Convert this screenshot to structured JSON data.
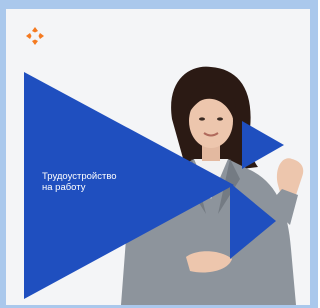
{
  "banner": {
    "caption": "Трудоустройство\nна работу"
  },
  "colors": {
    "outer_background": "#aac8ec",
    "card_background": "#f4f5f7",
    "triangle_blue": "#1f4fbf",
    "logo_orange": "#f47a20",
    "suit_gray": "#8d949c",
    "hair_dark": "#2b1a14"
  },
  "icons": {
    "logo": "arrows-logo-icon"
  }
}
